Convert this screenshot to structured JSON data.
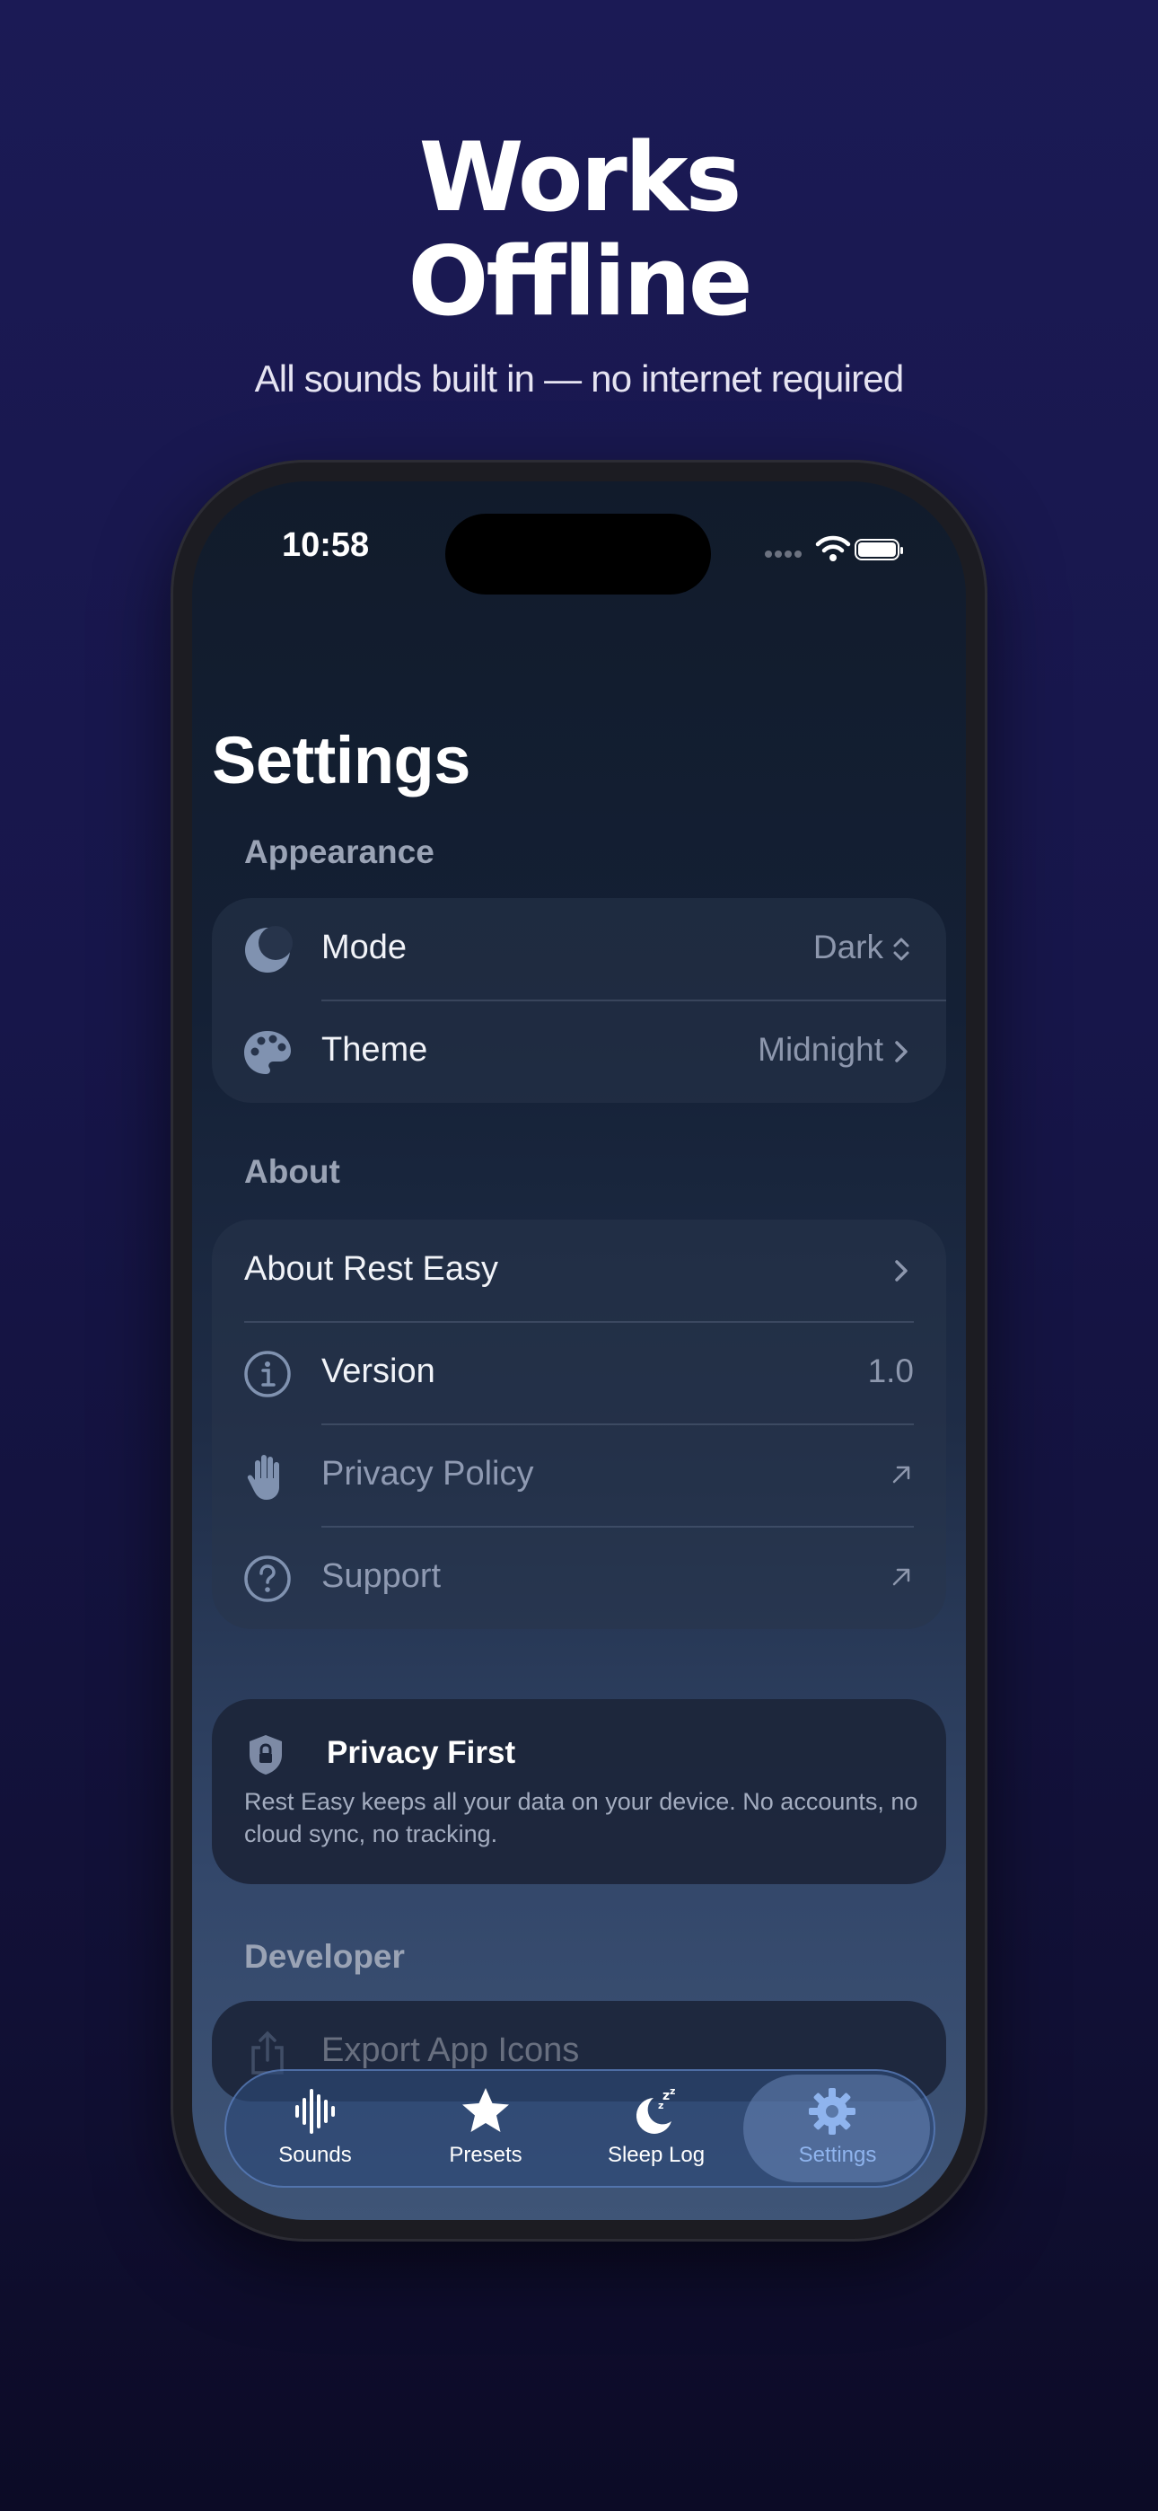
{
  "promo": {
    "headline_line1": "Works",
    "headline_line2": "Offline",
    "subheadline": "All sounds built in — no internet required"
  },
  "status_bar": {
    "time": "10:58"
  },
  "settings": {
    "title": "Settings",
    "appearance": {
      "section_label": "Appearance",
      "mode": {
        "label": "Mode",
        "value": "Dark",
        "icon": "moon-icon"
      },
      "theme": {
        "label": "Theme",
        "value": "Midnight",
        "icon": "palette-icon"
      }
    },
    "about": {
      "section_label": "About",
      "about_app": {
        "label": "About Rest Easy"
      },
      "version": {
        "label": "Version",
        "value": "1.0",
        "icon": "info-icon"
      },
      "privacy_policy": {
        "label": "Privacy Policy",
        "icon": "hand-icon"
      },
      "support": {
        "label": "Support",
        "icon": "question-icon"
      }
    },
    "privacy_card": {
      "title": "Privacy First",
      "body": "Rest Easy keeps all your data on your device. No accounts, no cloud sync, no tracking.",
      "icon": "shield-lock-icon"
    },
    "developer": {
      "section_label": "Developer",
      "export_icons": {
        "label": "Export App Icons",
        "icon": "share-icon"
      }
    }
  },
  "tab_bar": {
    "tabs": [
      {
        "label": "Sounds",
        "icon": "waveform-icon"
      },
      {
        "label": "Presets",
        "icon": "star-icon"
      },
      {
        "label": "Sleep Log",
        "icon": "moon-zzz-icon"
      },
      {
        "label": "Settings",
        "icon": "gear-icon",
        "selected": true
      }
    ]
  },
  "colors": {
    "background": "#1b1a55",
    "accent": "#8fb4ee",
    "text_secondary": "#8d97ad"
  }
}
